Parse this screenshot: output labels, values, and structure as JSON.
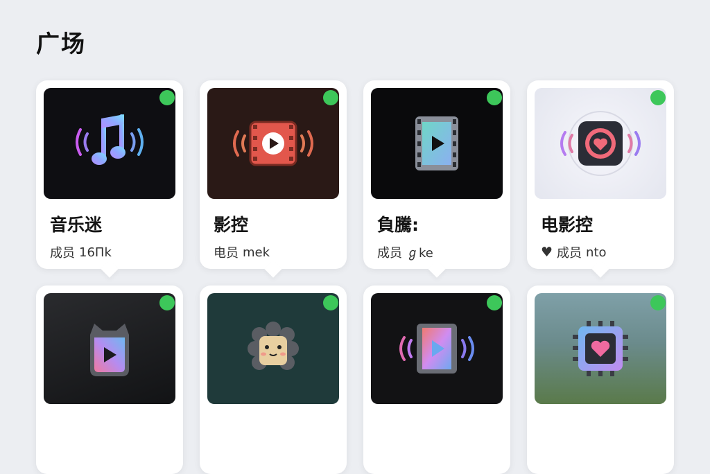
{
  "page": {
    "title": "广场"
  },
  "cards": [
    {
      "title": "音乐迷",
      "member_label": "成员",
      "member_value": "16Πk",
      "icon": "music-note-icon",
      "thumb_bg": "#0e0e12",
      "online": true
    },
    {
      "title": "影控",
      "member_label": "电员",
      "member_value": "mek",
      "icon": "video-play-icon",
      "thumb_bg": "#2a1916",
      "online": true
    },
    {
      "title": "負騰:",
      "member_label": "成员",
      "member_value": "ℊke",
      "icon": "film-strip-icon",
      "thumb_bg": "#0a0a0c",
      "online": true
    },
    {
      "title": "电影控",
      "member_label": "成员",
      "member_value": "nto",
      "icon": "heart-play-icon",
      "thumb_bg": "#e8e9f0",
      "online": true,
      "has_heart": true
    },
    {
      "icon": "cat-play-icon",
      "thumb_bg": "#1b1c1e",
      "online": true
    },
    {
      "icon": "lion-mascot-icon",
      "thumb_bg": "#1f3a3a",
      "online": true
    },
    {
      "icon": "film-gradient-icon",
      "thumb_bg": "#121214",
      "online": true
    },
    {
      "icon": "chip-heart-icon",
      "thumb_bg": "#6f8f94",
      "online": true
    }
  ]
}
